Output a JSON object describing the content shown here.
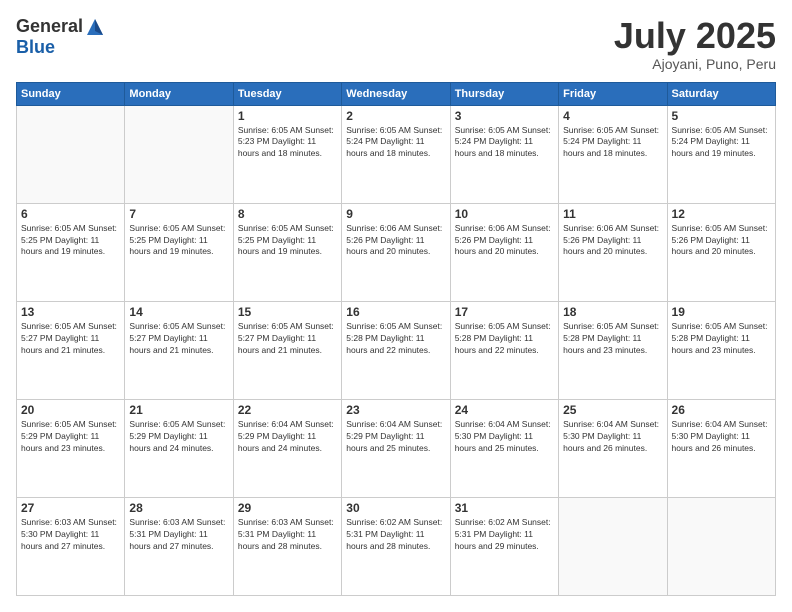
{
  "header": {
    "logo_general": "General",
    "logo_blue": "Blue",
    "title": "July 2025",
    "location": "Ajoyani, Puno, Peru"
  },
  "calendar": {
    "days_of_week": [
      "Sunday",
      "Monday",
      "Tuesday",
      "Wednesday",
      "Thursday",
      "Friday",
      "Saturday"
    ],
    "weeks": [
      [
        {
          "day": "",
          "info": ""
        },
        {
          "day": "",
          "info": ""
        },
        {
          "day": "1",
          "info": "Sunrise: 6:05 AM\nSunset: 5:23 PM\nDaylight: 11 hours and 18 minutes."
        },
        {
          "day": "2",
          "info": "Sunrise: 6:05 AM\nSunset: 5:24 PM\nDaylight: 11 hours and 18 minutes."
        },
        {
          "day": "3",
          "info": "Sunrise: 6:05 AM\nSunset: 5:24 PM\nDaylight: 11 hours and 18 minutes."
        },
        {
          "day": "4",
          "info": "Sunrise: 6:05 AM\nSunset: 5:24 PM\nDaylight: 11 hours and 18 minutes."
        },
        {
          "day": "5",
          "info": "Sunrise: 6:05 AM\nSunset: 5:24 PM\nDaylight: 11 hours and 19 minutes."
        }
      ],
      [
        {
          "day": "6",
          "info": "Sunrise: 6:05 AM\nSunset: 5:25 PM\nDaylight: 11 hours and 19 minutes."
        },
        {
          "day": "7",
          "info": "Sunrise: 6:05 AM\nSunset: 5:25 PM\nDaylight: 11 hours and 19 minutes."
        },
        {
          "day": "8",
          "info": "Sunrise: 6:05 AM\nSunset: 5:25 PM\nDaylight: 11 hours and 19 minutes."
        },
        {
          "day": "9",
          "info": "Sunrise: 6:06 AM\nSunset: 5:26 PM\nDaylight: 11 hours and 20 minutes."
        },
        {
          "day": "10",
          "info": "Sunrise: 6:06 AM\nSunset: 5:26 PM\nDaylight: 11 hours and 20 minutes."
        },
        {
          "day": "11",
          "info": "Sunrise: 6:06 AM\nSunset: 5:26 PM\nDaylight: 11 hours and 20 minutes."
        },
        {
          "day": "12",
          "info": "Sunrise: 6:05 AM\nSunset: 5:26 PM\nDaylight: 11 hours and 20 minutes."
        }
      ],
      [
        {
          "day": "13",
          "info": "Sunrise: 6:05 AM\nSunset: 5:27 PM\nDaylight: 11 hours and 21 minutes."
        },
        {
          "day": "14",
          "info": "Sunrise: 6:05 AM\nSunset: 5:27 PM\nDaylight: 11 hours and 21 minutes."
        },
        {
          "day": "15",
          "info": "Sunrise: 6:05 AM\nSunset: 5:27 PM\nDaylight: 11 hours and 21 minutes."
        },
        {
          "day": "16",
          "info": "Sunrise: 6:05 AM\nSunset: 5:28 PM\nDaylight: 11 hours and 22 minutes."
        },
        {
          "day": "17",
          "info": "Sunrise: 6:05 AM\nSunset: 5:28 PM\nDaylight: 11 hours and 22 minutes."
        },
        {
          "day": "18",
          "info": "Sunrise: 6:05 AM\nSunset: 5:28 PM\nDaylight: 11 hours and 23 minutes."
        },
        {
          "day": "19",
          "info": "Sunrise: 6:05 AM\nSunset: 5:28 PM\nDaylight: 11 hours and 23 minutes."
        }
      ],
      [
        {
          "day": "20",
          "info": "Sunrise: 6:05 AM\nSunset: 5:29 PM\nDaylight: 11 hours and 23 minutes."
        },
        {
          "day": "21",
          "info": "Sunrise: 6:05 AM\nSunset: 5:29 PM\nDaylight: 11 hours and 24 minutes."
        },
        {
          "day": "22",
          "info": "Sunrise: 6:04 AM\nSunset: 5:29 PM\nDaylight: 11 hours and 24 minutes."
        },
        {
          "day": "23",
          "info": "Sunrise: 6:04 AM\nSunset: 5:29 PM\nDaylight: 11 hours and 25 minutes."
        },
        {
          "day": "24",
          "info": "Sunrise: 6:04 AM\nSunset: 5:30 PM\nDaylight: 11 hours and 25 minutes."
        },
        {
          "day": "25",
          "info": "Sunrise: 6:04 AM\nSunset: 5:30 PM\nDaylight: 11 hours and 26 minutes."
        },
        {
          "day": "26",
          "info": "Sunrise: 6:04 AM\nSunset: 5:30 PM\nDaylight: 11 hours and 26 minutes."
        }
      ],
      [
        {
          "day": "27",
          "info": "Sunrise: 6:03 AM\nSunset: 5:30 PM\nDaylight: 11 hours and 27 minutes."
        },
        {
          "day": "28",
          "info": "Sunrise: 6:03 AM\nSunset: 5:31 PM\nDaylight: 11 hours and 27 minutes."
        },
        {
          "day": "29",
          "info": "Sunrise: 6:03 AM\nSunset: 5:31 PM\nDaylight: 11 hours and 28 minutes."
        },
        {
          "day": "30",
          "info": "Sunrise: 6:02 AM\nSunset: 5:31 PM\nDaylight: 11 hours and 28 minutes."
        },
        {
          "day": "31",
          "info": "Sunrise: 6:02 AM\nSunset: 5:31 PM\nDaylight: 11 hours and 29 minutes."
        },
        {
          "day": "",
          "info": ""
        },
        {
          "day": "",
          "info": ""
        }
      ]
    ]
  }
}
